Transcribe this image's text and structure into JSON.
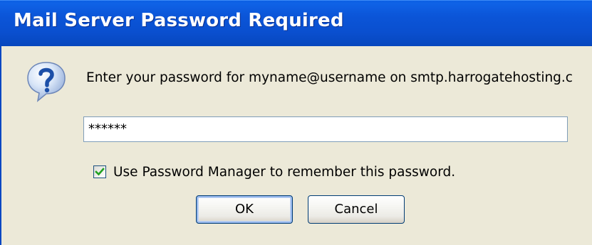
{
  "dialog": {
    "title": "Mail Server Password Required",
    "icon": "question-icon",
    "prompt": "Enter your password for myname@username on smtp.harrogatehosting.c",
    "password_value": "******",
    "remember_checked": true,
    "remember_label": "Use Password Manager to remember this password.",
    "ok_label": "OK",
    "cancel_label": "Cancel"
  },
  "colors": {
    "titlebar": "#0a4fcf",
    "dialog_bg": "#ece9d8",
    "checkmark": "#21a121",
    "button_border": "#003c74"
  }
}
